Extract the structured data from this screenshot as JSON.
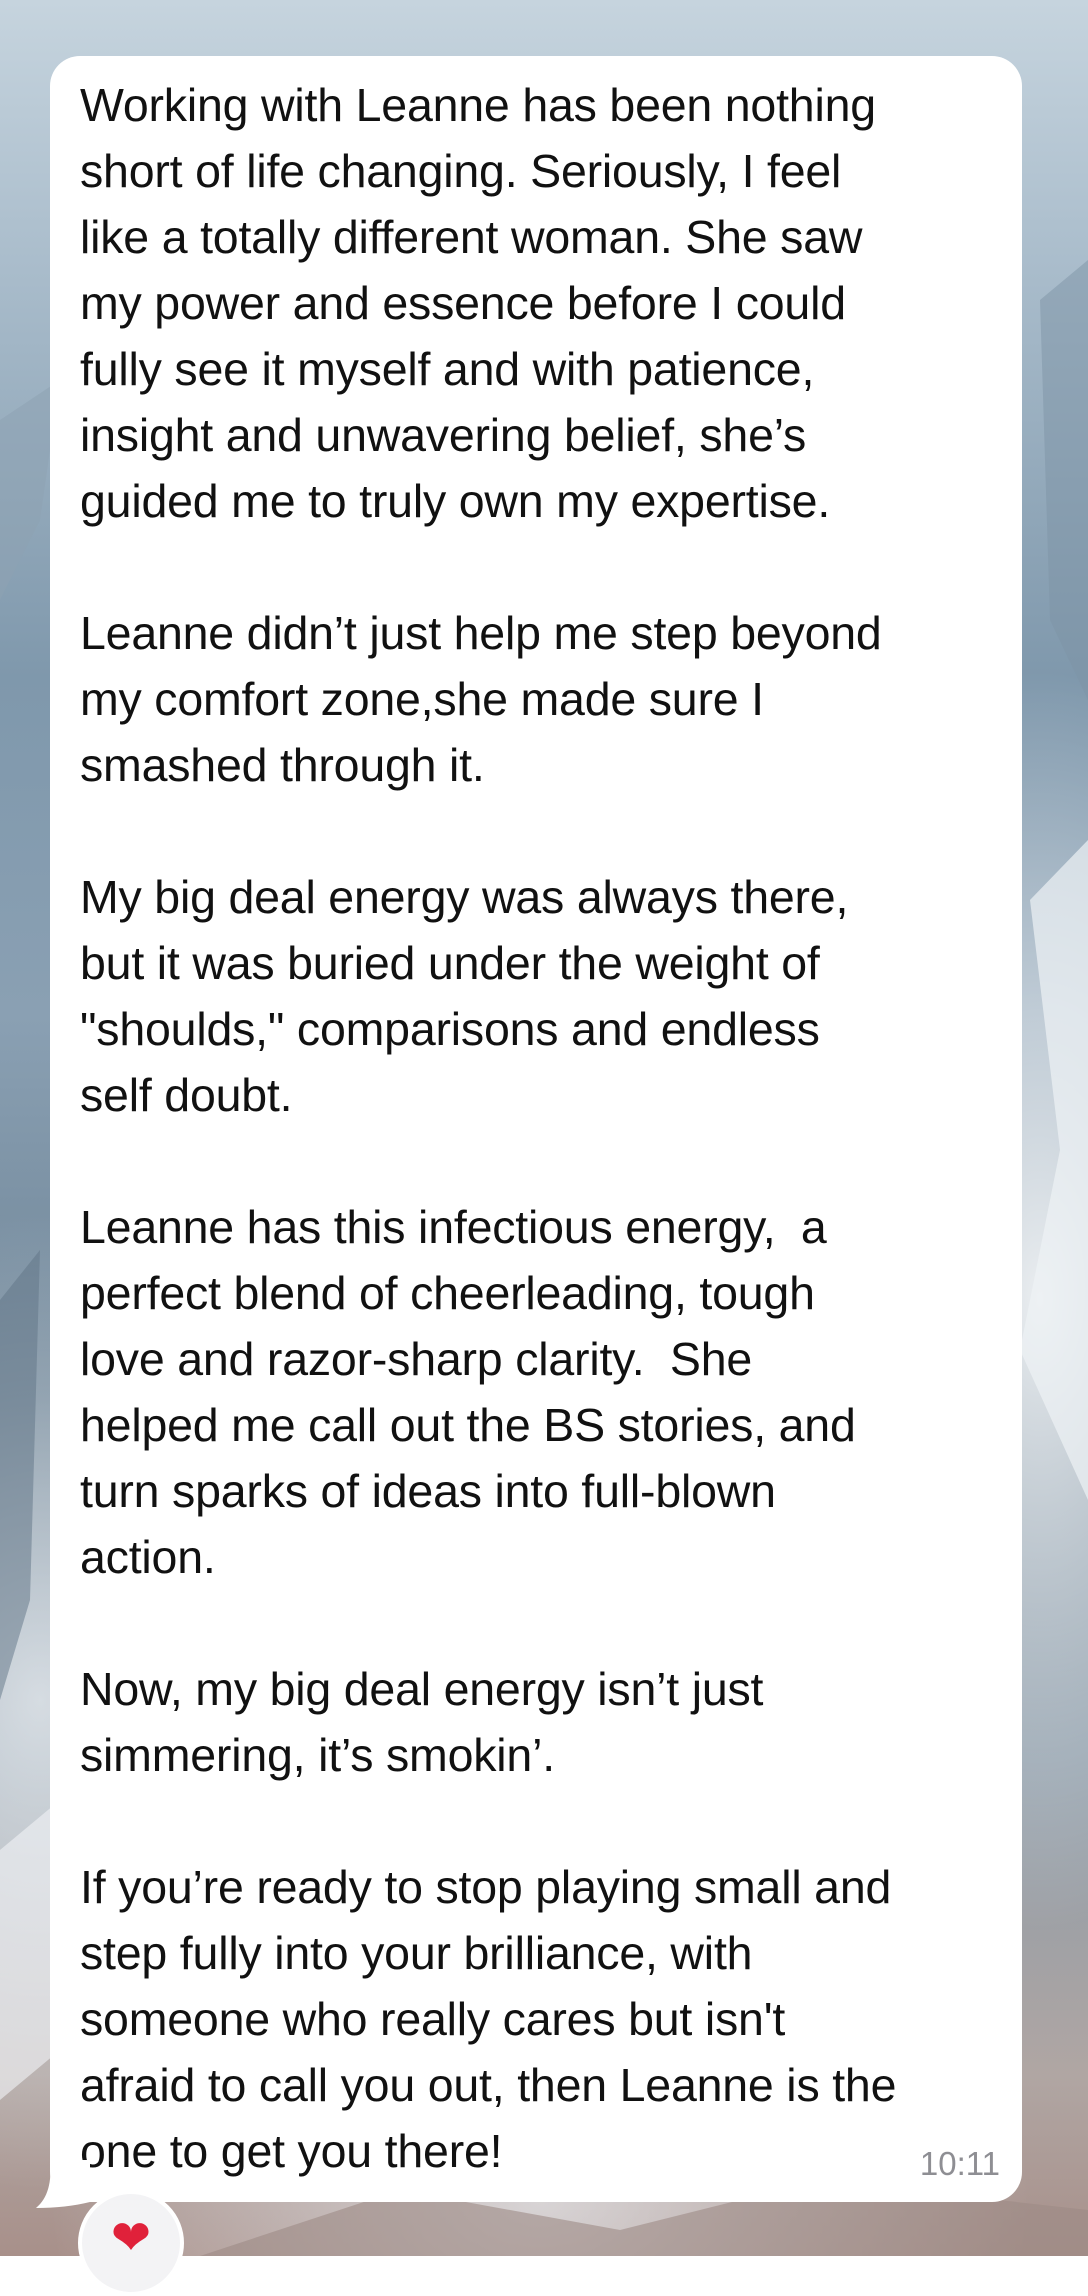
{
  "message": {
    "text": "Working with Leanne has been nothing\nshort of life changing. Seriously, I feel\nlike a totally different woman. She saw\nmy power and essence before I could\nfully see it myself and with patience,\ninsight and unwavering belief, she’s\nguided me to truly own my expertise.\n\nLeanne didn’t just help me step beyond\nmy comfort zone,she made sure I\nsmashed through it.\n\nMy big deal energy was always there,\nbut it was buried under the weight of\n\"shoulds,\" comparisons and endless\nself doubt.\n\nLeanne has this infectious energy,  a\nperfect blend of cheerleading, tough\nlove and razor-sharp clarity.  She\nhelped me call out the BS stories, and\nturn sparks of ideas into full-blown\naction.\n\nNow, my big deal energy isn’t just\nsimmering, it’s smokin’.\n\nIf you’re ready to stop playing small and\nstep fully into your brilliance, with\nsomeone who really cares but isn't\nafraid to call you out, then Leanne is the\none to get you there!",
    "time": "10:11"
  },
  "reaction": {
    "icon": "heart-icon",
    "glyph": "❤",
    "color": "#e0213a"
  },
  "colors": {
    "bubble": "#ffffff",
    "text": "#111111",
    "time": "#8e8e93"
  }
}
